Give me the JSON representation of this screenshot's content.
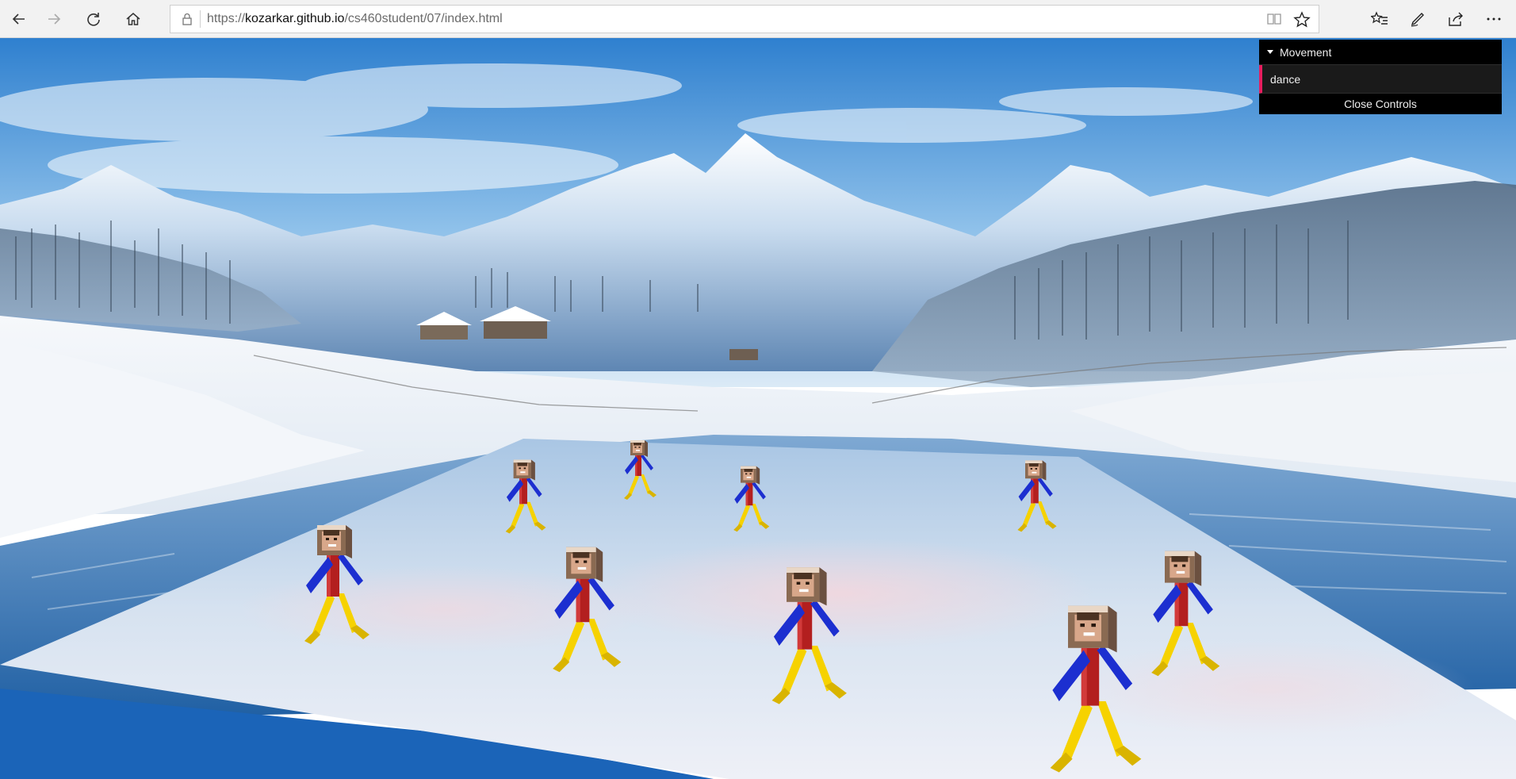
{
  "browser": {
    "url_scheme": "https://",
    "url_host": "kozarkar.github.io",
    "url_path": "/cs460student/07/index.html",
    "icons": [
      "back-icon",
      "forward-icon",
      "refresh-icon",
      "home-icon",
      "lock-icon",
      "reading-view-icon",
      "favorite-star-icon",
      "favorites-list-icon",
      "pen-icon",
      "share-icon",
      "more-icon"
    ]
  },
  "gui": {
    "folder_label": "Movement",
    "controller_label": "dance",
    "close_label": "Close Controls",
    "accent": "#e61d5f"
  },
  "scene": {
    "description_colors": {
      "sky": "#3d8fd6",
      "snow": "#f2f5f9",
      "ice": "#b9d2ea",
      "torso": "#b31f1f",
      "arms": "#1c2fd0",
      "legs": "#f6d200"
    }
  }
}
